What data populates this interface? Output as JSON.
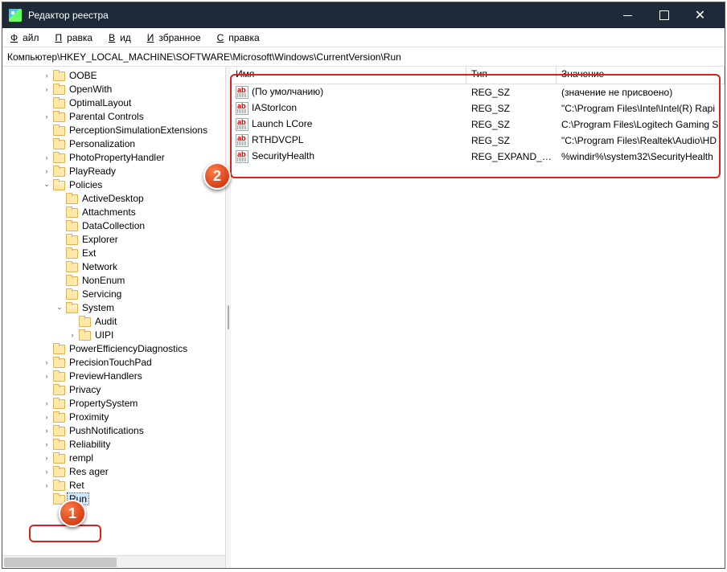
{
  "window": {
    "title": "Редактор реестра"
  },
  "menu": {
    "file": "Файл",
    "edit": "Правка",
    "view": "Вид",
    "favorites": "Избранное",
    "help": "Справка"
  },
  "path": "Компьютер\\HKEY_LOCAL_MACHINE\\SOFTWARE\\Microsoft\\Windows\\CurrentVersion\\Run",
  "tree": [
    {
      "d": 3,
      "t": ">",
      "l": "OOBE"
    },
    {
      "d": 3,
      "t": ">",
      "l": "OpenWith"
    },
    {
      "d": 3,
      "t": " ",
      "l": "OptimalLayout"
    },
    {
      "d": 3,
      "t": ">",
      "l": "Parental Controls"
    },
    {
      "d": 3,
      "t": " ",
      "l": "PerceptionSimulationExtensions"
    },
    {
      "d": 3,
      "t": " ",
      "l": "Personalization"
    },
    {
      "d": 3,
      "t": ">",
      "l": "PhotoPropertyHandler"
    },
    {
      "d": 3,
      "t": ">",
      "l": "PlayReady"
    },
    {
      "d": 3,
      "t": "v",
      "l": "Policies",
      "open": true
    },
    {
      "d": 4,
      "t": " ",
      "l": "ActiveDesktop"
    },
    {
      "d": 4,
      "t": " ",
      "l": "Attachments"
    },
    {
      "d": 4,
      "t": " ",
      "l": "DataCollection"
    },
    {
      "d": 4,
      "t": " ",
      "l": "Explorer"
    },
    {
      "d": 4,
      "t": " ",
      "l": "Ext"
    },
    {
      "d": 4,
      "t": " ",
      "l": "Network"
    },
    {
      "d": 4,
      "t": " ",
      "l": "NonEnum"
    },
    {
      "d": 4,
      "t": " ",
      "l": "Servicing"
    },
    {
      "d": 4,
      "t": "v",
      "l": "System",
      "open": true
    },
    {
      "d": 5,
      "t": " ",
      "l": "Audit"
    },
    {
      "d": 5,
      "t": ">",
      "l": "UIPI"
    },
    {
      "d": 3,
      "t": " ",
      "l": "PowerEfficiencyDiagnostics"
    },
    {
      "d": 3,
      "t": ">",
      "l": "PrecisionTouchPad"
    },
    {
      "d": 3,
      "t": ">",
      "l": "PreviewHandlers"
    },
    {
      "d": 3,
      "t": " ",
      "l": "Privacy"
    },
    {
      "d": 3,
      "t": ">",
      "l": "PropertySystem"
    },
    {
      "d": 3,
      "t": ">",
      "l": "Proximity"
    },
    {
      "d": 3,
      "t": ">",
      "l": "PushNotifications"
    },
    {
      "d": 3,
      "t": ">",
      "l": "Reliability"
    },
    {
      "d": 3,
      "t": ">",
      "l": "rempl"
    },
    {
      "d": 3,
      "t": ">",
      "l": "Res       ager"
    },
    {
      "d": 3,
      "t": ">",
      "l": "Ret"
    },
    {
      "d": 3,
      "t": " ",
      "l": "Run",
      "sel": true
    }
  ],
  "columns": {
    "name": "Имя",
    "type": "Тип",
    "value": "Значение"
  },
  "rows": [
    {
      "n": "(По умолчанию)",
      "t": "REG_SZ",
      "v": "(значение не присвоено)"
    },
    {
      "n": "IAStorIcon",
      "t": "REG_SZ",
      "v": "\"C:\\Program Files\\Intel\\Intel(R) Rapi"
    },
    {
      "n": "Launch LCore",
      "t": "REG_SZ",
      "v": "C:\\Program Files\\Logitech Gaming S"
    },
    {
      "n": "RTHDVCPL",
      "t": "REG_SZ",
      "v": "\"C:\\Program Files\\Realtek\\Audio\\HD"
    },
    {
      "n": "SecurityHealth",
      "t": "REG_EXPAND_SZ",
      "v": "%windir%\\system32\\SecurityHealth"
    }
  ],
  "callouts": {
    "c1": "1",
    "c2": "2"
  }
}
